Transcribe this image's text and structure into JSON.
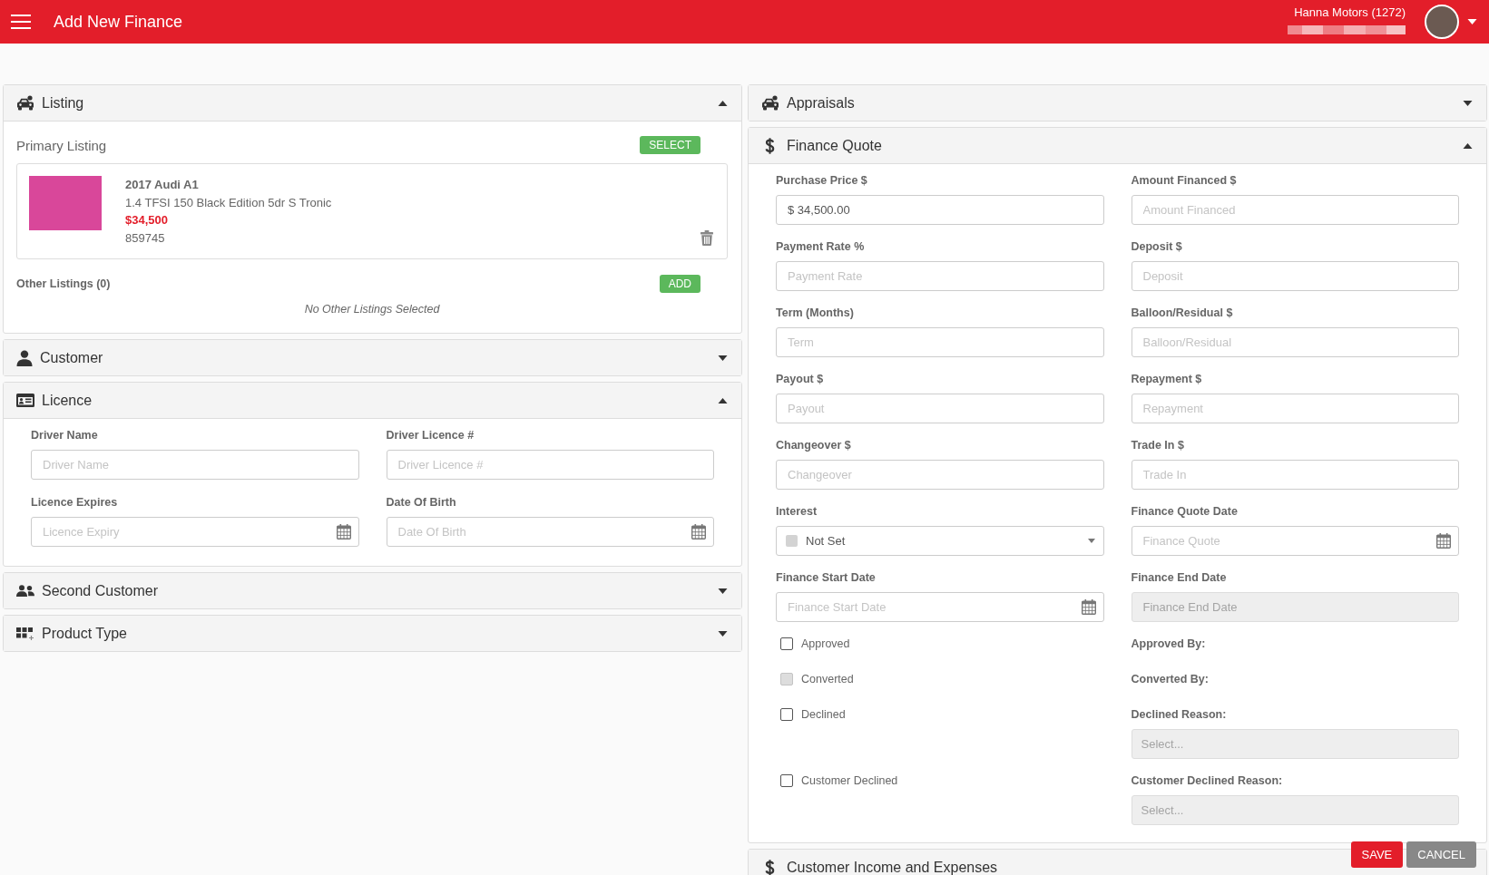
{
  "app_bar": {
    "title": "Add New Finance",
    "account_name": "Hanna Motors (1272)"
  },
  "left_panels": [
    {
      "kind": "listing",
      "title": "Listing",
      "expanded": true,
      "primary_label": "Primary Listing",
      "select_button": "SELECT",
      "vehicle": {
        "title": "2017 Audi A1",
        "description": "1.4 TFSI 150 Black Edition 5dr S Tronic",
        "price": "$34,500",
        "stock_number": "859745"
      },
      "other_label": "Other Listings (0)",
      "add_button": "ADD",
      "empty_message": "No Other Listings Selected"
    },
    {
      "title": "Customer",
      "expanded": false
    },
    {
      "kind": "form",
      "title": "Licence",
      "expanded": true,
      "fields": [
        {
          "kind": "text",
          "label": "Driver Name",
          "placeholder": "Driver Name",
          "disabled": false
        },
        {
          "kind": "text",
          "label": "Driver Licence #",
          "placeholder": "Driver Licence #",
          "disabled": false
        },
        {
          "kind": "date",
          "label": "Licence Expires",
          "placeholder": "Licence Expiry",
          "disabled": false
        },
        {
          "kind": "date",
          "label": "Date Of Birth",
          "placeholder": "Date Of Birth",
          "disabled": false
        }
      ]
    },
    {
      "title": "Second Customer",
      "expanded": false
    },
    {
      "title": "Product Type",
      "expanded": false
    }
  ],
  "right_panels": [
    {
      "title": "Appraisals",
      "expanded": false
    },
    {
      "kind": "form",
      "title": "Finance Quote",
      "expanded": true,
      "fields": [
        {
          "kind": "text",
          "label": "Purchase Price $",
          "value": "$ 34,500.00",
          "disabled": false
        },
        {
          "kind": "text",
          "label": "Amount Financed $",
          "placeholder": "Amount Financed",
          "disabled": false
        },
        {
          "kind": "text",
          "label": "Payment Rate %",
          "placeholder": "Payment Rate",
          "disabled": false
        },
        {
          "kind": "text",
          "label": "Deposit $",
          "placeholder": "Deposit",
          "disabled": false
        },
        {
          "kind": "text",
          "label": "Term (Months)",
          "placeholder": "Term",
          "disabled": false
        },
        {
          "kind": "text",
          "label": "Balloon/Residual $",
          "placeholder": "Balloon/Residual",
          "disabled": false
        },
        {
          "kind": "text",
          "label": "Payout $",
          "placeholder": "Payout",
          "disabled": false
        },
        {
          "kind": "text",
          "label": "Repayment $",
          "placeholder": "Repayment",
          "disabled": false
        },
        {
          "kind": "text",
          "label": "Changeover $",
          "placeholder": "Changeover",
          "disabled": false
        },
        {
          "kind": "text",
          "label": "Trade In $",
          "placeholder": "Trade In",
          "disabled": false
        },
        {
          "kind": "select",
          "label": "Interest",
          "value": "Not Set",
          "color": "#d3d3d3",
          "disabled": false
        },
        {
          "kind": "date",
          "label": "Finance Quote Date",
          "placeholder": "Finance Quote",
          "disabled": false
        },
        {
          "kind": "date",
          "label": "Finance Start Date",
          "placeholder": "Finance Start Date",
          "disabled": false
        },
        {
          "kind": "text",
          "label": "Finance End Date",
          "placeholder": "Finance End Date",
          "disabled": true
        },
        {
          "kind": "checkbox",
          "label": "Approved",
          "checked": false,
          "disabled": false
        },
        {
          "kind": "info",
          "label": "Approved By:"
        },
        {
          "kind": "checkbox",
          "label": "Converted",
          "checked": false,
          "disabled": true
        },
        {
          "kind": "info",
          "label": "Converted By:"
        },
        {
          "kind": "checkbox",
          "label": "Declined",
          "checked": false,
          "disabled": false
        },
        {
          "kind": "select",
          "label": "Declined Reason:",
          "placeholder": "Select...",
          "disabled": true
        },
        {
          "kind": "checkbox",
          "label": "Customer Declined",
          "checked": false,
          "disabled": false
        },
        {
          "kind": "select",
          "label": "Customer Declined Reason:",
          "placeholder": "Select...",
          "disabled": true
        }
      ]
    },
    {
      "title": "Customer Income and Expenses"
    }
  ],
  "actions": [
    {
      "kind": "primary",
      "label": "SAVE"
    },
    {
      "kind": "secondary",
      "label": "CANCEL"
    }
  ]
}
